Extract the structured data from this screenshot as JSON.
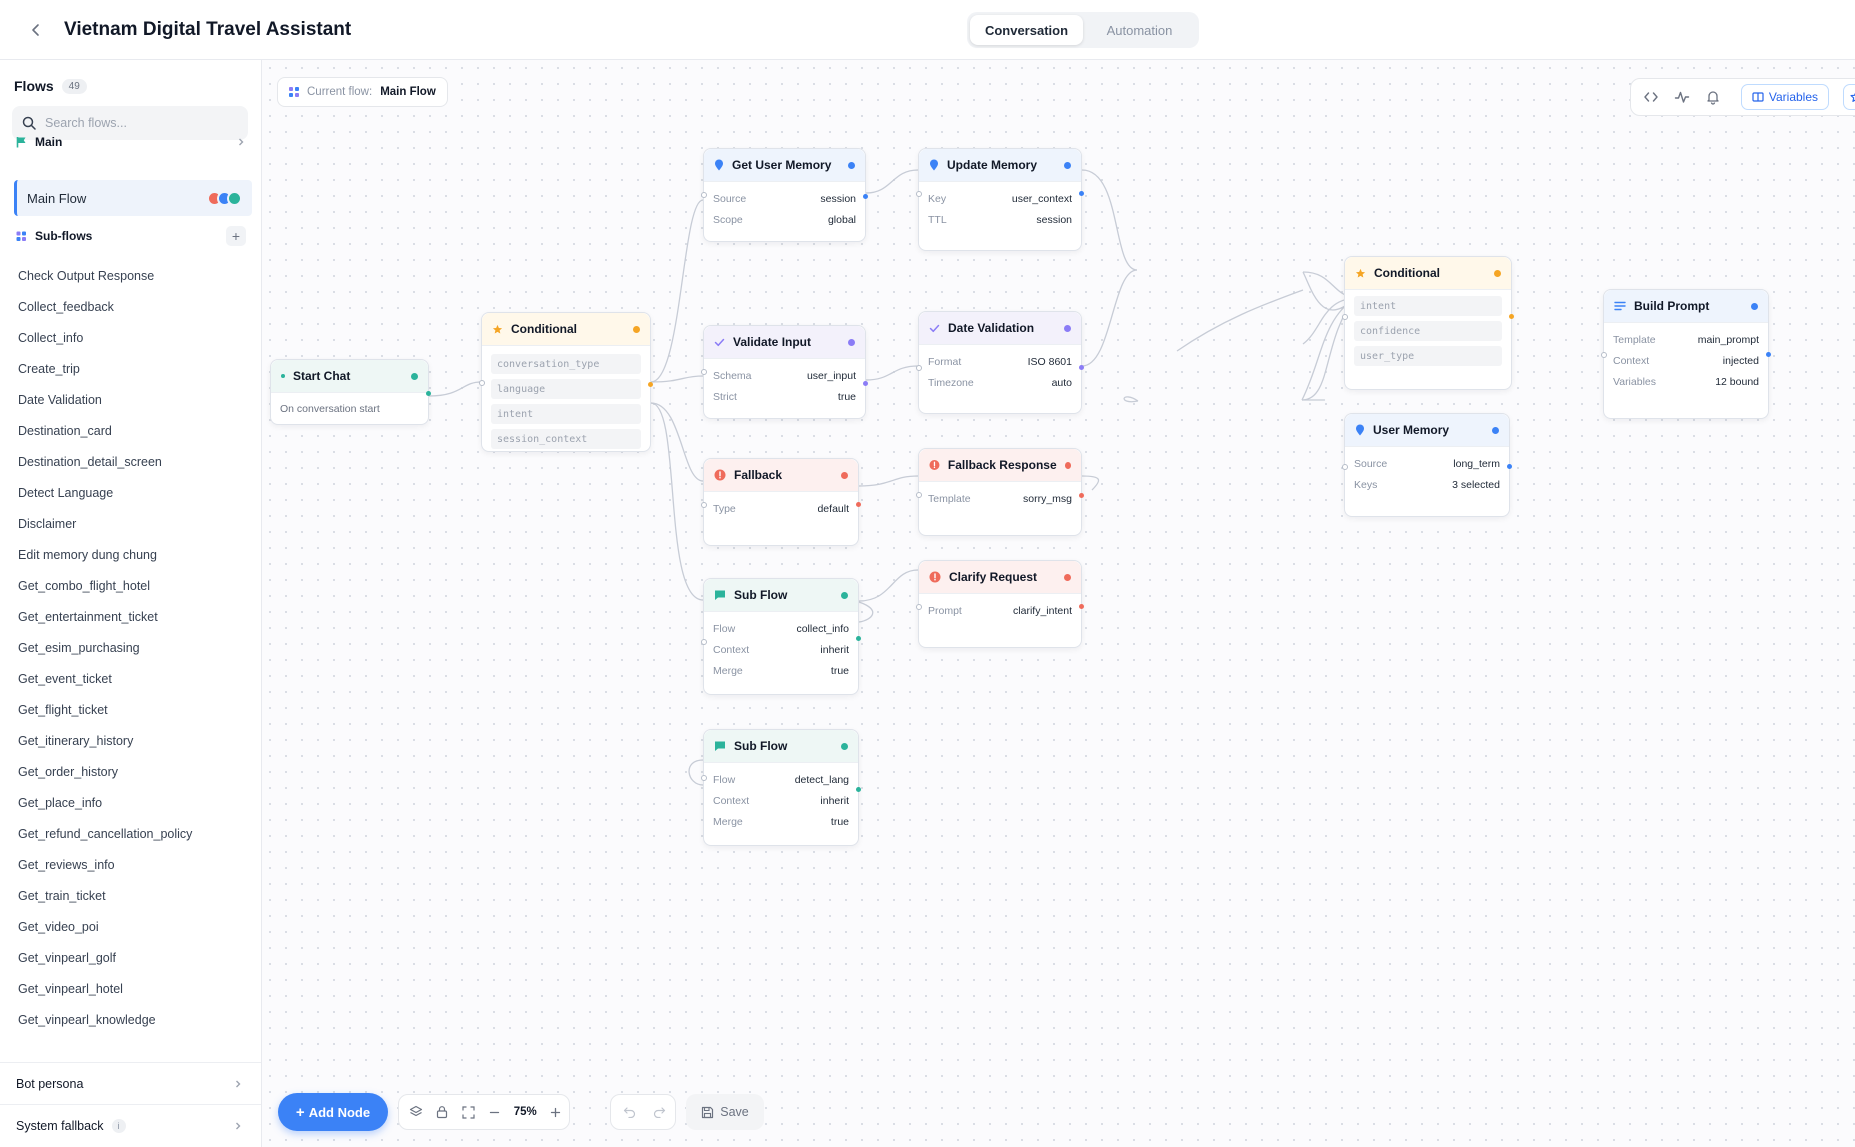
{
  "header": {
    "title": "Vietnam Digital Travel Assistant",
    "tabs": [
      {
        "label": "Conversation",
        "active": true
      },
      {
        "label": "Automation",
        "active": false
      }
    ]
  },
  "sidebar": {
    "title": "Flows",
    "count": "49",
    "search_placeholder": "Search flows...",
    "main_section": "Main",
    "main_flow": "Main Flow",
    "subflows_section": "Sub-flows",
    "subflows": [
      "Check Output Response",
      "Collect_feedback",
      "Collect_info",
      "Create_trip",
      "Date Validation",
      "Destination_card",
      "Destination_detail_screen",
      "Detect Language",
      "Disclaimer",
      "Edit memory dung chung",
      "Get_combo_flight_hotel",
      "Get_entertainment_ticket",
      "Get_esim_purchasing",
      "Get_event_ticket",
      "Get_flight_ticket",
      "Get_itinerary_history",
      "Get_order_history",
      "Get_place_info",
      "Get_refund_cancellation_policy",
      "Get_reviews_info",
      "Get_train_ticket",
      "Get_video_poi",
      "Get_vinpearl_golf",
      "Get_vinpearl_hotel",
      "Get_vinpearl_knowledge"
    ],
    "footer": [
      {
        "label": "Bot persona"
      },
      {
        "label": "System fallback"
      }
    ]
  },
  "canvas": {
    "current_flow_label": "Current flow:",
    "current_flow_value": "Main Flow",
    "variables_label": "Variables",
    "zoom": "75%",
    "add_node_label": "Add Node",
    "save_label": "Save"
  },
  "colors": {
    "accent": "#3b82f6",
    "teal": "#2bb39b",
    "amber": "#f5a524",
    "blue": "#3b82f6",
    "purple": "#8b7cf6",
    "red": "#ef6b5b"
  },
  "nodes": {
    "start": {
      "title": "Start Chat",
      "note": "On conversation start"
    },
    "cond1": {
      "title": "Conditional",
      "fields": [
        "conversation_type",
        "language",
        "intent",
        "session_context"
      ]
    },
    "getmem": {
      "title": "Get User Memory",
      "rows": [
        {
          "k": "Source",
          "v": "session"
        },
        {
          "k": "Scope",
          "v": "global"
        }
      ]
    },
    "validate": {
      "title": "Validate Input",
      "rows": [
        {
          "k": "Schema",
          "v": "user_input"
        },
        {
          "k": "Strict",
          "v": "true"
        }
      ]
    },
    "fallback": {
      "title": "Fallback",
      "rows": [
        {
          "k": "Type",
          "v": "default"
        }
      ]
    },
    "sub1": {
      "title": "Sub Flow",
      "rows": [
        {
          "k": "Flow",
          "v": "collect_info"
        },
        {
          "k": "Context",
          "v": "inherit"
        },
        {
          "k": "Merge",
          "v": "true"
        }
      ]
    },
    "sub2": {
      "title": "Sub Flow",
      "rows": [
        {
          "k": "Flow",
          "v": "detect_lang"
        },
        {
          "k": "Context",
          "v": "inherit"
        },
        {
          "k": "Merge",
          "v": "true"
        }
      ]
    },
    "updmem": {
      "title": "Update Memory",
      "rows": [
        {
          "k": "Key",
          "v": "user_context"
        },
        {
          "k": "TTL",
          "v": "session"
        }
      ]
    },
    "datev": {
      "title": "Date Validation",
      "rows": [
        {
          "k": "Format",
          "v": "ISO 8601"
        },
        {
          "k": "Timezone",
          "v": "auto"
        }
      ]
    },
    "fbresp": {
      "title": "Fallback Response",
      "rows": [
        {
          "k": "Template",
          "v": "sorry_msg"
        }
      ]
    },
    "clarify": {
      "title": "Clarify Request",
      "rows": [
        {
          "k": "Prompt",
          "v": "clarify_intent"
        }
      ]
    },
    "cond2": {
      "title": "Conditional",
      "fields": [
        "intent",
        "confidence",
        "user_type"
      ]
    },
    "usermem": {
      "title": "User Memory",
      "rows": [
        {
          "k": "Source",
          "v": "long_term"
        },
        {
          "k": "Keys",
          "v": "3 selected"
        }
      ]
    },
    "build": {
      "title": "Build Prompt",
      "rows": [
        {
          "k": "Template",
          "v": "main_prompt"
        },
        {
          "k": "Context",
          "v": "injected"
        },
        {
          "k": "Variables",
          "v": "12 bound"
        }
      ]
    }
  }
}
